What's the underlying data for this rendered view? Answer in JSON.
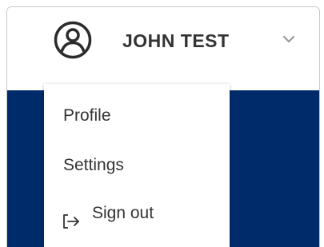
{
  "user": {
    "name": "JOHN TEST",
    "avatar_icon": "user-circle-icon",
    "dropdown_icon": "chevron-down-icon"
  },
  "menu": {
    "items": [
      {
        "label": "Profile"
      },
      {
        "label": "Settings"
      },
      {
        "label": "Sign out",
        "icon": "sign-out-icon"
      }
    ]
  },
  "colors": {
    "banner": "#002b6b",
    "text": "#333333",
    "chevron": "#9a9a9a"
  }
}
